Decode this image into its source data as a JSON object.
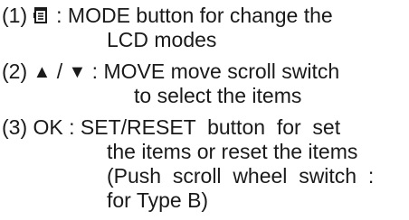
{
  "items": [
    {
      "number": "(1)",
      "icon": "mode-document-icon",
      "line1_rest": ": MODE button for change the",
      "line2": "LCD modes"
    },
    {
      "number": "(2)",
      "up_symbol": "▲",
      "separator": " / ",
      "down_symbol": "▼",
      "line1_rest": " : MOVE move scroll switch",
      "line2": "to select the items"
    },
    {
      "number": "(3)",
      "key": "OK",
      "line1_rest": " : SET/RESET  button  for  set",
      "line2": "the items or reset the items",
      "line3": "(Push  scroll  wheel  switch  :",
      "line4": "for Type B)"
    }
  ]
}
